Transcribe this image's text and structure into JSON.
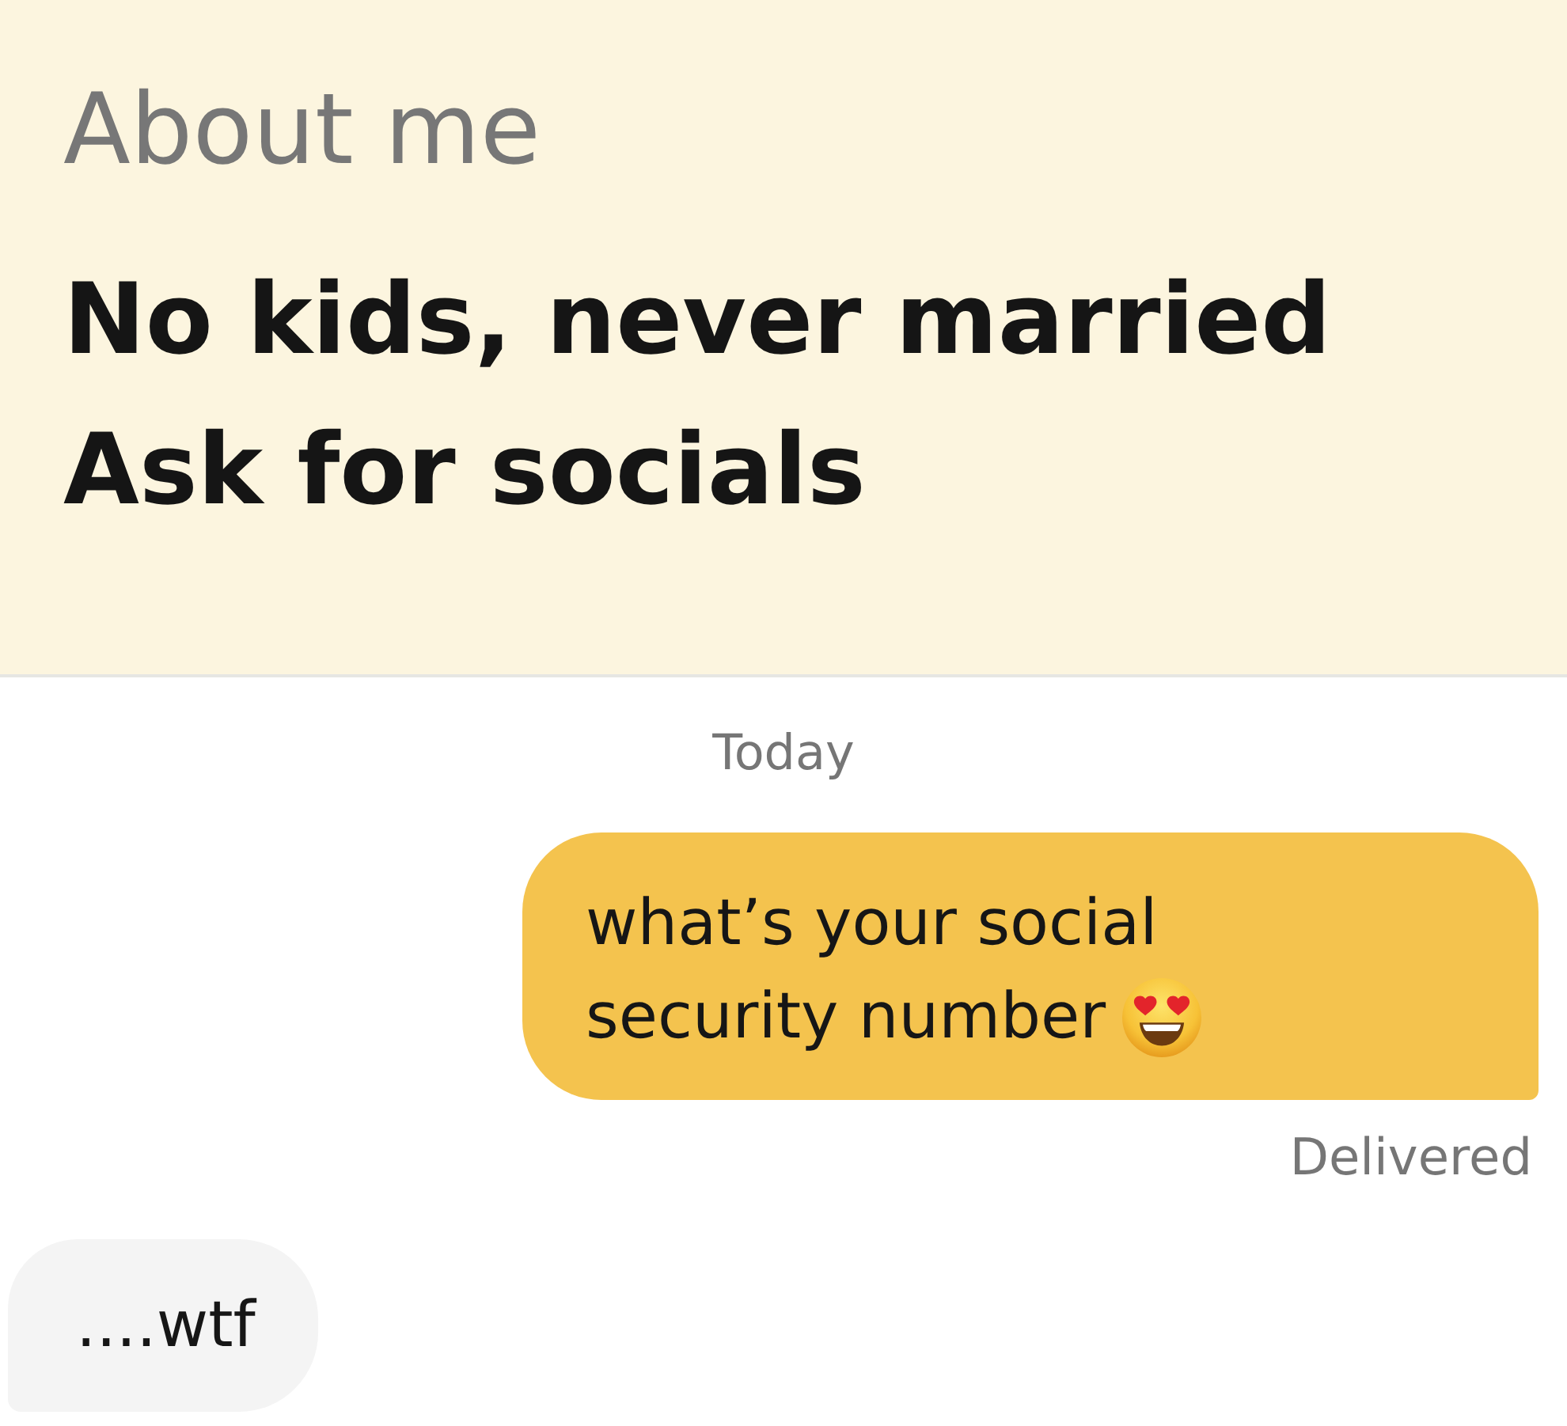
{
  "about": {
    "heading": "About me",
    "lines": [
      "No kids, never married",
      "Ask for socials"
    ]
  },
  "chat": {
    "date_separator": "Today",
    "messages": [
      {
        "kind": "sent",
        "text": "what’s your social security number",
        "emoji": true,
        "status": "Delivered"
      },
      {
        "kind": "received",
        "text": "....wtf",
        "emoji": false
      }
    ]
  }
}
